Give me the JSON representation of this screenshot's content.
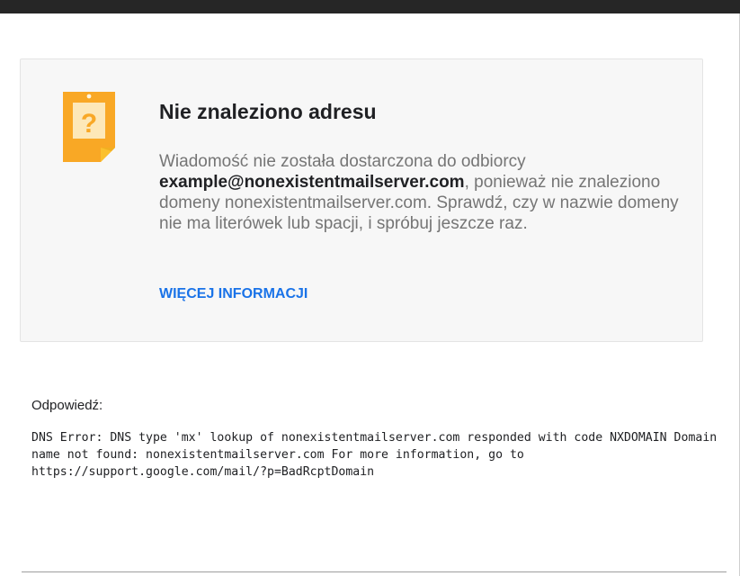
{
  "notice": {
    "icon": "warning-note-icon",
    "accent_color": "#f9a825",
    "title": "Nie znaleziono adresu",
    "message_prefix": "Wiadomość nie została dostarczona do odbiorcy ",
    "recipient": "example@nonexistentmailserver.com",
    "message_suffix": ", ponieważ nie znaleziono domeny nonexistentmailserver.com. Sprawdź, czy w nazwie domeny nie ma literówek lub spacji, i spróbuj jeszcze raz.",
    "more_info_label": "WIĘCEJ INFORMACJI",
    "link_color": "#1a73e8"
  },
  "reply": {
    "label": "Odpowiedź:",
    "body": "DNS Error: DNS type 'mx' lookup of nonexistentmailserver.com responded with code NXDOMAIN Domain name not found: nonexistentmailserver.com For more information, go to https://support.google.com/mail/?p=BadRcptDomain"
  }
}
